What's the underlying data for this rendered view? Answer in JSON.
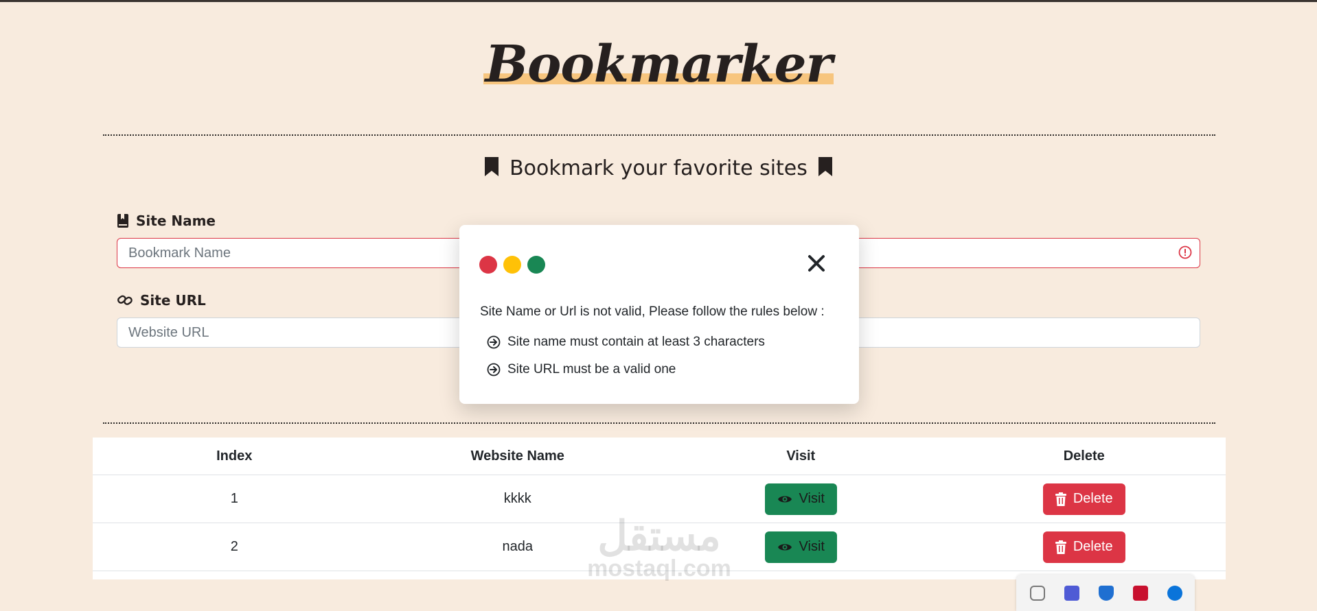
{
  "app": {
    "logo": "Bookmarker",
    "heading": "Bookmark your favorite sites"
  },
  "form": {
    "site_name_label": "Site Name",
    "site_name_placeholder": "Bookmark Name",
    "site_url_label": "Site URL",
    "site_url_placeholder": "Website URL"
  },
  "table": {
    "headers": [
      "Index",
      "Website Name",
      "Visit",
      "Delete"
    ],
    "rows": [
      {
        "index": "1",
        "name": "kkkk",
        "visit": "Visit",
        "delete": "Delete"
      },
      {
        "index": "2",
        "name": "nada",
        "visit": "Visit",
        "delete": "Delete"
      }
    ]
  },
  "modal": {
    "message": "Site Name or Url is not valid, Please follow the rules below :",
    "rules": [
      "Site name must contain at least 3 characters",
      "Site URL must be a valid one"
    ],
    "dot_colors": [
      "#dc3545",
      "#ffc107",
      "#198754"
    ]
  },
  "watermark": {
    "arabic": "مستقل",
    "latin": "mostaql.com"
  },
  "colors": {
    "background": "#f8ebde",
    "danger": "#dc3545",
    "success": "#198754",
    "warning": "#ffc107",
    "highlight": "#f7c57e"
  },
  "tray_icons": [
    "discord-icon",
    "app-icon",
    "defender-icon",
    "mcafee-icon",
    "bluetooth-icon"
  ]
}
